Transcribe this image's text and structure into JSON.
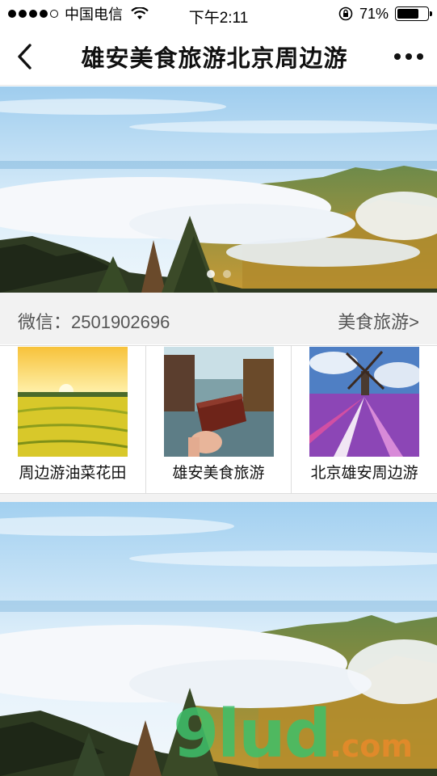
{
  "status_bar": {
    "carrier": "中国电信",
    "time": "下午2:11",
    "battery": "71%",
    "battery_level": 0.71
  },
  "nav": {
    "title": "雄安美食旅游北京周边游",
    "back_icon": "chevron-left-icon",
    "more_icon": "more-horizontal-icon"
  },
  "banner": {
    "page_count": 2,
    "active_page": 1
  },
  "info": {
    "wechat": "微信：2501902696",
    "food_travel_link": "美食旅游>"
  },
  "categories": [
    {
      "label": "周边游油菜花田",
      "thumb": "rapeseed-field"
    },
    {
      "label": "雄安美食旅游",
      "thumb": "canal-cake"
    },
    {
      "label": "北京雄安周边游",
      "thumb": "windmill-flowers"
    }
  ],
  "watermark": {
    "brand": "9lud",
    "domain": ".com"
  },
  "colors": {
    "sky": "#a9d4f2",
    "cloud": "#f4f7fa",
    "mountain": "#5f7a3b",
    "accent_green": "#3ec06a",
    "accent_orange": "#e58a2a"
  }
}
